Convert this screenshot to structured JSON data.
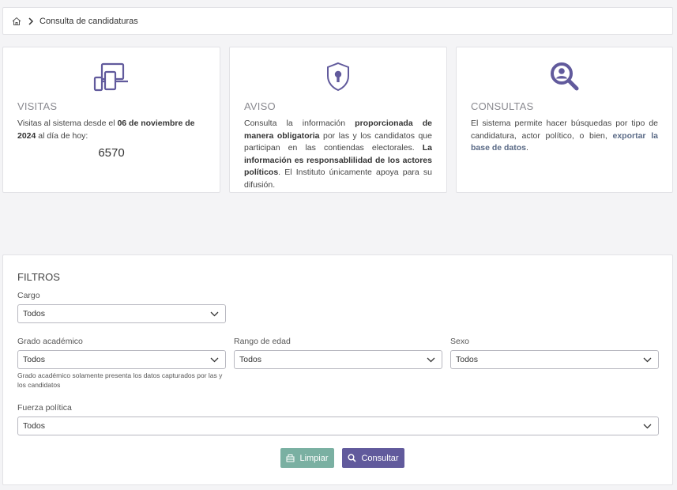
{
  "breadcrumb": {
    "current": "Consulta de candidaturas"
  },
  "cards": {
    "visits": {
      "title": "VISITAS",
      "text_pre": "Visitas al sistema desde el ",
      "date": "06 de noviembre de 2024",
      "text_post": " al día de hoy:",
      "count": "6570"
    },
    "notice": {
      "title": "AVISO",
      "p1": "Consulta la información ",
      "b1": "proporcionada de manera obligatoria",
      "p2": " por las y los candidatos que participan en las contiendas electorales. ",
      "b2": "La información es responsablilidad de los actores políticos",
      "p3": ". El Instituto únicamente apoya para su difusión."
    },
    "queries": {
      "title": "CONSULTAS",
      "p1": "El sistema permite hacer búsquedas por tipo de candidatura, actor político, o bien, ",
      "link": "exportar la base de datos",
      "p2": "."
    }
  },
  "filters": {
    "title": "FILTROS",
    "cargo": {
      "label": "Cargo",
      "value": "Todos"
    },
    "grado": {
      "label": "Grado académico",
      "value": "Todos",
      "help": "Grado académico solamente presenta los datos capturados por las y los candidatos"
    },
    "edad": {
      "label": "Rango de edad",
      "value": "Todos"
    },
    "sexo": {
      "label": "Sexo",
      "value": "Todos"
    },
    "fuerza": {
      "label": "Fuerza política",
      "value": "Todos"
    },
    "clear_label": "Limpiar",
    "query_label": "Consultar"
  },
  "colors": {
    "accent": "#615a9c",
    "clear": "#7ab0a2"
  }
}
